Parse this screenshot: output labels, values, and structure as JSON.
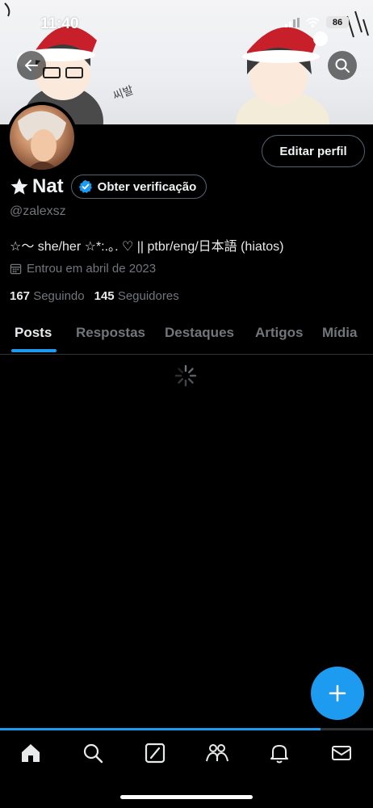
{
  "status_bar": {
    "time": "11:40",
    "battery": "86"
  },
  "profile": {
    "display_name": "Nat",
    "handle": "@zalexsz",
    "bio": "☆〜 she/her ☆*:.｡. ♡ || ptbr/eng/日本語 (hiatos)",
    "joined": "Entrou em abril de 2023",
    "following_count": "167",
    "following_label": "Seguindo",
    "followers_count": "145",
    "followers_label": "Seguidores"
  },
  "buttons": {
    "edit_profile": "Editar perfil",
    "get_verified": "Obter verificação"
  },
  "tabs": [
    {
      "label": "Posts",
      "active": true
    },
    {
      "label": "Respostas",
      "active": false
    },
    {
      "label": "Destaques",
      "active": false
    },
    {
      "label": "Artigos",
      "active": false
    },
    {
      "label": "Mídia",
      "active": false
    }
  ],
  "loading_progress": 0.86,
  "icons": {
    "back": "back-arrow-icon",
    "search": "search-icon",
    "star": "star-icon",
    "verified": "verified-badge-icon",
    "calendar": "calendar-icon",
    "compose": "plus-icon",
    "nav": [
      "home-icon",
      "explore-icon",
      "grok-icon",
      "communities-icon",
      "notifications-icon",
      "messages-icon"
    ]
  },
  "colors": {
    "accent": "#1d9bf0",
    "background": "#000000",
    "secondary_text": "#71767b"
  }
}
